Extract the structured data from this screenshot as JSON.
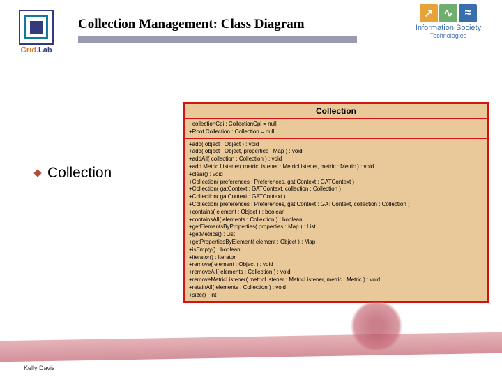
{
  "header": {
    "title": "Collection Management: Class Diagram",
    "logo_left": {
      "line1": "Grid.",
      "line2": "Lab"
    },
    "logo_right": {
      "line1": "Information Society",
      "line2": "Technologies",
      "glyphs": [
        "↗",
        "∿",
        "≈"
      ]
    }
  },
  "bullet": {
    "text": "Collection"
  },
  "uml": {
    "class_name": "Collection",
    "attributes": [
      "- collectionCpi : CollectionCpi = null",
      "+Root.Collection : Collection = null"
    ],
    "operations": [
      "+add( object : Object ) : void",
      "+add( object : Object, properties : Map ) : void",
      "+addAll( collection : Collection ) : void",
      "+add.Metric.Listener( metricListener : MetricListener, metric : Metric ) : void",
      "+clear() : void",
      "+Collection( preferences : Preferences, gat.Context : GATContext )",
      "+Collection( gatContext : GATContext, collection : Collection )",
      "+Collection( gatContext : GATContext )",
      "+Collection( preferences : Preferences, gat.Context : GATContext, collection : Collection )",
      "+contains( element : Object ) : boolean",
      "+containsAll( elements : Collection ) : boolean",
      "+getElementsByProperties( properties : Map ) : List",
      "+getMetrics() : List",
      "+getPropertiesByElement( element : Object ) : Map",
      "+isEmpty() : boolean",
      "+iterator() : Iterator",
      "+remove( element : Object ) : void",
      "+removeAll( elements : Collection ) : void",
      "+removeMetricListener( metricListener : MetricListener, metric : Metric ) : void",
      "+retainAll( elements : Collection ) : void",
      "+size() : int"
    ]
  },
  "footer": {
    "author": "Kelly Davis"
  }
}
